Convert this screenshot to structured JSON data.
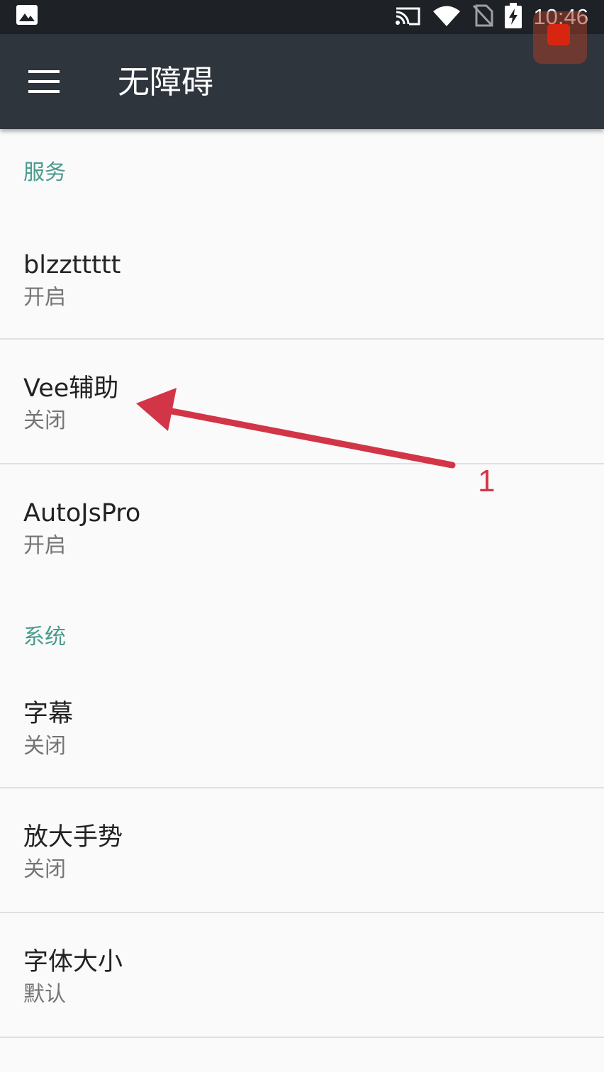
{
  "status_bar": {
    "time": "10:46",
    "icons": [
      "image-icon",
      "cast-icon",
      "wifi-icon",
      "no-sim-icon",
      "battery-charging-icon"
    ]
  },
  "app_bar": {
    "title": "无障碍",
    "menu_icon": "hamburger-menu-icon"
  },
  "sections": [
    {
      "header": "服务",
      "items": [
        {
          "title": "blzzttttt",
          "subtitle": "开启"
        },
        {
          "title": "Vee辅助",
          "subtitle": "关闭"
        },
        {
          "title": "AutoJsPro",
          "subtitle": "开启"
        }
      ]
    },
    {
      "header": "系统",
      "items": [
        {
          "title": "字幕",
          "subtitle": "关闭"
        },
        {
          "title": "放大手势",
          "subtitle": "关闭"
        },
        {
          "title": "字体大小",
          "subtitle": "默认"
        }
      ]
    }
  ],
  "annotation": {
    "label": "1",
    "color": "#d23547"
  },
  "colors": {
    "section_header": "#4a9b8d",
    "app_bar": "#2f353c",
    "status_bar": "#1e2226",
    "record_button": "#d7260f"
  }
}
